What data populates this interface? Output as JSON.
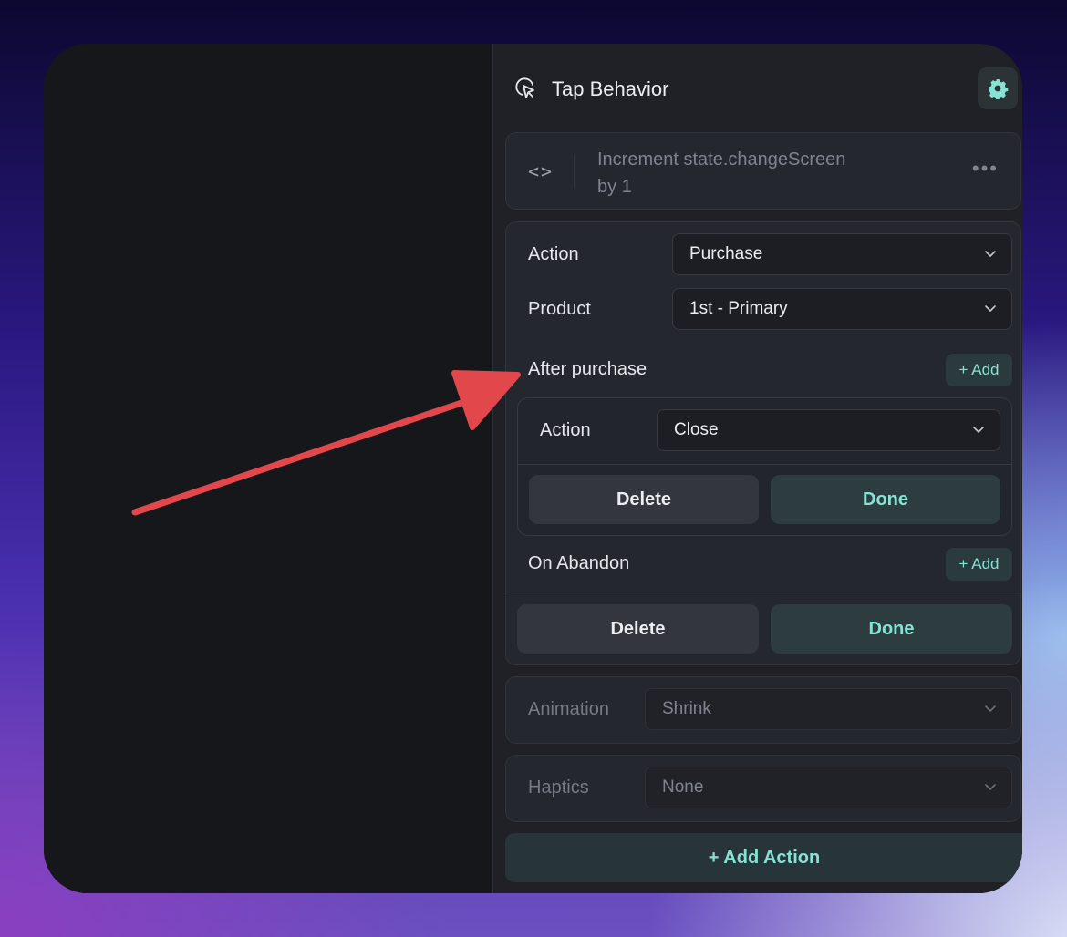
{
  "panel": {
    "title": "Tap Behavior",
    "title_icon": "cursor-click-icon",
    "settings_icon": "gear-icon"
  },
  "code_action": {
    "icon": "code-icon",
    "line1": "Increment state.changeScreen",
    "line2": "by 1",
    "more_icon": "more-horizontal-icon"
  },
  "purchase_action": {
    "action_label": "Action",
    "action_value": "Purchase",
    "product_label": "Product",
    "product_value": "1st - Primary",
    "after_purchase_label": "After purchase",
    "after_purchase_add": "+ Add",
    "after_purchase_item": {
      "action_label": "Action",
      "action_value": "Close",
      "delete_label": "Delete",
      "done_label": "Done"
    },
    "on_abandon_label": "On Abandon",
    "on_abandon_add": "+ Add",
    "delete_label": "Delete",
    "done_label": "Done"
  },
  "animation": {
    "label": "Animation",
    "value": "Shrink"
  },
  "haptics": {
    "label": "Haptics",
    "value": "None"
  },
  "add_action_label": "+ Add Action",
  "colors": {
    "accent": "#86e3d3",
    "annotation_arrow": "#e2474b"
  }
}
